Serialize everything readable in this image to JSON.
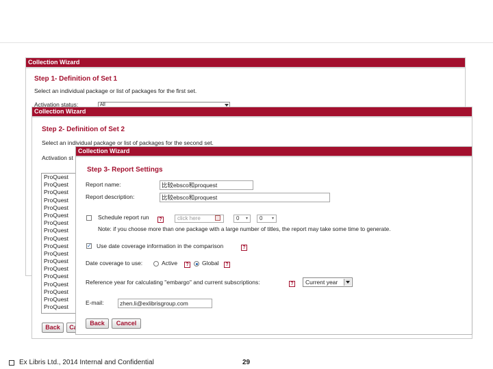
{
  "slide": {
    "footer_text": "Ex Libris Ltd., 2014  Internal and Confidential",
    "page_number": "29"
  },
  "dialog1": {
    "window_title": "Collection Wizard",
    "step_title": "Step 1- Definition of Set 1",
    "instruction": "Select an individual package or list of packages for the first set.",
    "activation_label": "Activation status:",
    "activation_value": "All"
  },
  "dialog2": {
    "window_title": "Collection Wizard",
    "step_title": "Step 2- Definition of Set 2",
    "instruction": "Select an individual package or list of packages for the second set.",
    "activation_label": "Activation st",
    "list_items": [
      "ProQuest",
      "ProQuest",
      "ProQuest",
      "ProQuest",
      "ProQuest",
      "ProQuest",
      "ProQuest",
      "ProQuest",
      "ProQuest",
      "ProQuest",
      "ProQuest",
      "ProQuest",
      "ProQuest",
      "ProQuest",
      "ProQuest",
      "ProQuest",
      "ProQuest",
      "ProQuest"
    ],
    "back_label": "Back",
    "cancel_label": "Ca"
  },
  "dialog3": {
    "window_title": "Collection Wizard",
    "step_title": "Step 3- Report Settings",
    "report_name_label": "Report name:",
    "report_name_value": "比较ebsco和proquest",
    "report_description_label": "Report description:",
    "report_description_value": "比较ebsco和proquest",
    "schedule_label": "Schedule report run",
    "date_placeholder": "click here",
    "hour_value": "0",
    "minute_value": "0",
    "note": "Note: if you choose more than one package with a large number of titles, the report may take some time to generate.",
    "use_date_coverage_label": "Use date coverage information in the comparison",
    "date_coverage_label": "Date coverage to use:",
    "active_label": "Active",
    "global_label": "Global",
    "selected_coverage": "Global",
    "reference_year_label": "Reference year for calculating \"embargo\" and current subscriptions:",
    "reference_year_value": "Current year",
    "email_label": "E-mail:",
    "email_value": "zhen.li@exlibrisgroup.com",
    "back_label": "Back",
    "cancel_label": "Cancel"
  },
  "colors": {
    "brand": "#a3102e",
    "radio_selected": "#1d5ea8"
  },
  "icons": [
    "help-icon",
    "calendar-icon",
    "checkbox-checked-icon",
    "dropdown-arrow-icon",
    "footer-bullet-square-icon"
  ]
}
